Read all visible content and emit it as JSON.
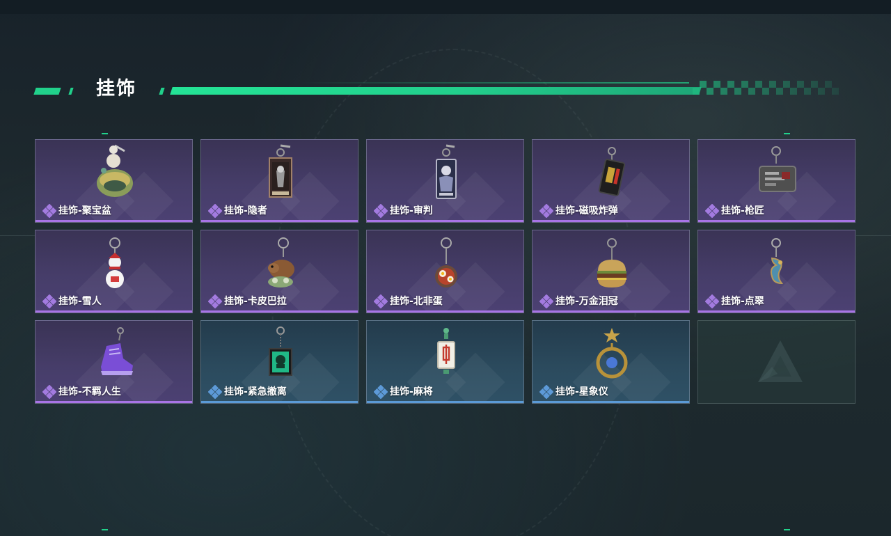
{
  "section": {
    "title": "挂饰"
  },
  "colors": {
    "accent": "#21d18b",
    "epic_bar": "#a874e6",
    "rare_bar": "#5b9ad6"
  },
  "items": [
    {
      "label": "挂饰-聚宝盆",
      "rarity": "epic",
      "icon": "treasure-bowl-charm-icon"
    },
    {
      "label": "挂饰-隐者",
      "rarity": "epic",
      "icon": "hermit-card-charm-icon"
    },
    {
      "label": "挂饰-审判",
      "rarity": "epic",
      "icon": "judgement-card-charm-icon"
    },
    {
      "label": "挂饰-磁吸炸弹",
      "rarity": "epic",
      "icon": "magnetic-bomb-charm-icon"
    },
    {
      "label": "挂饰-枪匠",
      "rarity": "epic",
      "icon": "gunsmith-charm-icon"
    },
    {
      "label": "挂饰-雪人",
      "rarity": "epic",
      "icon": "snowman-charm-icon"
    },
    {
      "label": "挂饰-卡皮巴拉",
      "rarity": "epic",
      "icon": "capybara-charm-icon"
    },
    {
      "label": "挂饰-北非蛋",
      "rarity": "epic",
      "icon": "shakshuka-charm-icon"
    },
    {
      "label": "挂饰-万金泪冠",
      "rarity": "epic",
      "icon": "burger-charm-icon"
    },
    {
      "label": "挂饰-点翠",
      "rarity": "epic",
      "icon": "kingfisher-charm-icon"
    },
    {
      "label": "挂饰-不羁人生",
      "rarity": "epic",
      "icon": "sneaker-charm-icon"
    },
    {
      "label": "挂饰-紧急撤离",
      "rarity": "rare",
      "icon": "emergency-evac-charm-icon"
    },
    {
      "label": "挂饰-麻将",
      "rarity": "rare",
      "icon": "mahjong-charm-icon"
    },
    {
      "label": "挂饰-星象仪",
      "rarity": "rare",
      "icon": "astrolabe-charm-icon"
    }
  ],
  "empty_slot": {
    "icon": "game-logo-icon"
  }
}
